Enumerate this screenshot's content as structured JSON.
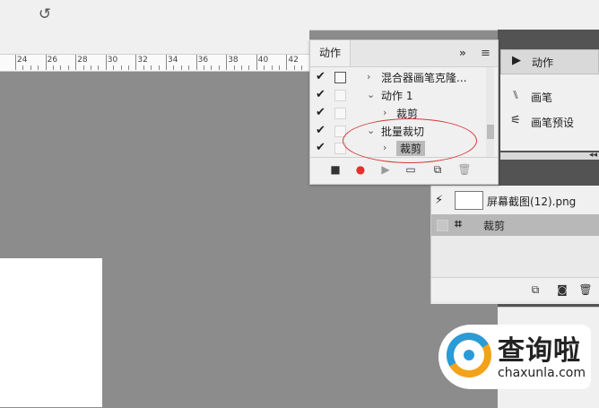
{
  "toolbar": {
    "undo_icon": "rotate-left-icon"
  },
  "ruler": {
    "labels": [
      "24",
      "26",
      "28",
      "30",
      "32",
      "34",
      "36",
      "38",
      "40",
      "42"
    ]
  },
  "actions_panel": {
    "tab_label": "动作",
    "rows": [
      {
        "checked": true,
        "dialog": true,
        "expanded": false,
        "label": "混合器画笔克隆...",
        "indent": 0
      },
      {
        "checked": true,
        "dialog": false,
        "expanded": true,
        "label": "动作 1",
        "indent": 0
      },
      {
        "checked": true,
        "dialog": false,
        "expanded": false,
        "label": "裁剪",
        "indent": 1
      },
      {
        "checked": true,
        "dialog": false,
        "expanded": true,
        "label": "批量裁切",
        "indent": 0
      },
      {
        "checked": true,
        "dialog": false,
        "expanded": false,
        "label": "裁剪",
        "indent": 1,
        "selected": true
      }
    ],
    "bottom_buttons": [
      "stop-icon",
      "record-icon",
      "play-icon",
      "folder-icon",
      "new-action-icon",
      "trash-icon"
    ],
    "colors": {
      "record": "#e0322d"
    }
  },
  "dock": {
    "items": [
      {
        "icon": "play-icon",
        "label": "动作"
      },
      {
        "icon": "brushes-icon",
        "label": "画笔"
      },
      {
        "icon": "brush-presets-icon",
        "label": "画笔预设"
      }
    ]
  },
  "history_panel": {
    "snapshot_label": "屏幕截图(12).png",
    "step_label": "裁剪"
  },
  "watermark": {
    "title": "查询啦",
    "url": "chaxunla.com"
  }
}
